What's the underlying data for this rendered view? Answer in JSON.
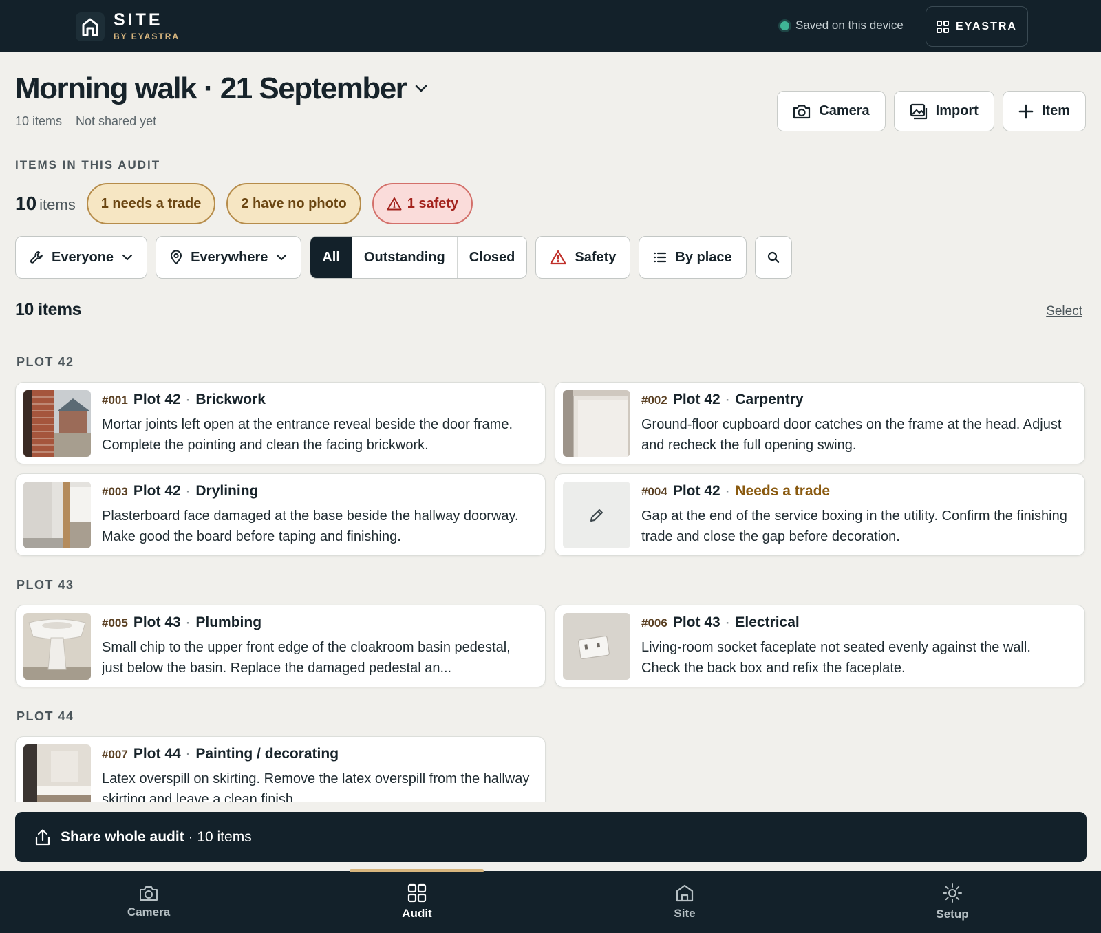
{
  "brand": {
    "name": "SITE",
    "sub": "BY EYASTRA"
  },
  "topbar": {
    "saved_text": "Saved on this device",
    "account_label": "EYASTRA"
  },
  "header": {
    "title": "Morning walk · 21 September",
    "item_count": "10 items",
    "share_status": "Not shared yet"
  },
  "actions": {
    "camera": "Camera",
    "import": "Import",
    "item": "Item"
  },
  "summary": {
    "section_label": "ITEMS IN THIS AUDIT",
    "count": "10",
    "count_word": "items",
    "needs_trade": "1 needs a trade",
    "no_photo": "2 have no photo",
    "safety": "1 safety"
  },
  "filters": {
    "who": "Everyone",
    "where": "Everywhere",
    "status_tabs": [
      "All",
      "Outstanding",
      "Closed"
    ],
    "active_status": "All",
    "safety": "Safety",
    "group_by": "By place"
  },
  "list": {
    "heading": "10 items",
    "select": "Select",
    "groups": [
      {
        "label": "PLOT 42",
        "items": [
          {
            "num": "#001",
            "plot": "Plot 42",
            "trade": "Brickwork",
            "desc": "Mortar joints left open at the entrance reveal beside the door frame. Complete the pointing and clean the facing brickwork.",
            "photo": "brick-photo"
          },
          {
            "num": "#002",
            "plot": "Plot 42",
            "trade": "Carpentry",
            "desc": "Ground-floor cupboard door catches on the frame at the head. Adjust and recheck the full opening swing.",
            "photo": "door-photo"
          },
          {
            "num": "#003",
            "plot": "Plot 42",
            "trade": "Drylining",
            "desc": "Plasterboard face damaged at the base beside the hallway doorway. Make good the board before taping and finishing.",
            "photo": "hallway-photo"
          },
          {
            "num": "#004",
            "plot": "Plot 42",
            "trade": "Needs a trade",
            "desc": "Gap at the end of the service boxing in the utility. Confirm the finishing trade and close the gap before decoration.",
            "photo": "none"
          }
        ]
      },
      {
        "label": "PLOT 43",
        "items": [
          {
            "num": "#005",
            "plot": "Plot 43",
            "trade": "Plumbing",
            "desc": "Small chip to the upper front edge of the cloakroom basin pedestal, just below the basin. Replace the damaged pedestal an...",
            "photo": "basin-photo"
          },
          {
            "num": "#006",
            "plot": "Plot 43",
            "trade": "Electrical",
            "desc": "Living-room socket faceplate not seated evenly against the wall. Check the back box and refix the faceplate.",
            "photo": "socket-photo"
          }
        ]
      },
      {
        "label": "PLOT 44",
        "items": [
          {
            "num": "#007",
            "plot": "Plot 44",
            "trade": "Painting / decorating",
            "desc": "Latex overspill on skirting. Remove the latex overspill from the hallway skirting and leave a clean finish.",
            "photo": "skirting-photo"
          }
        ]
      }
    ]
  },
  "share": {
    "label": "Share whole audit",
    "count": " · 10 items"
  },
  "nav": {
    "items": [
      {
        "label": "Camera",
        "icon": "camera-icon"
      },
      {
        "label": "Audit",
        "icon": "grid-icon"
      },
      {
        "label": "Site",
        "icon": "home-icon"
      },
      {
        "label": "Setup",
        "icon": "sun-icon"
      }
    ],
    "active": "Audit"
  },
  "colors": {
    "ink": "#13212a",
    "accent": "#d8b67e",
    "amber": "#f6e6c3",
    "danger": "#d3706a",
    "saved": "#3fb596"
  }
}
